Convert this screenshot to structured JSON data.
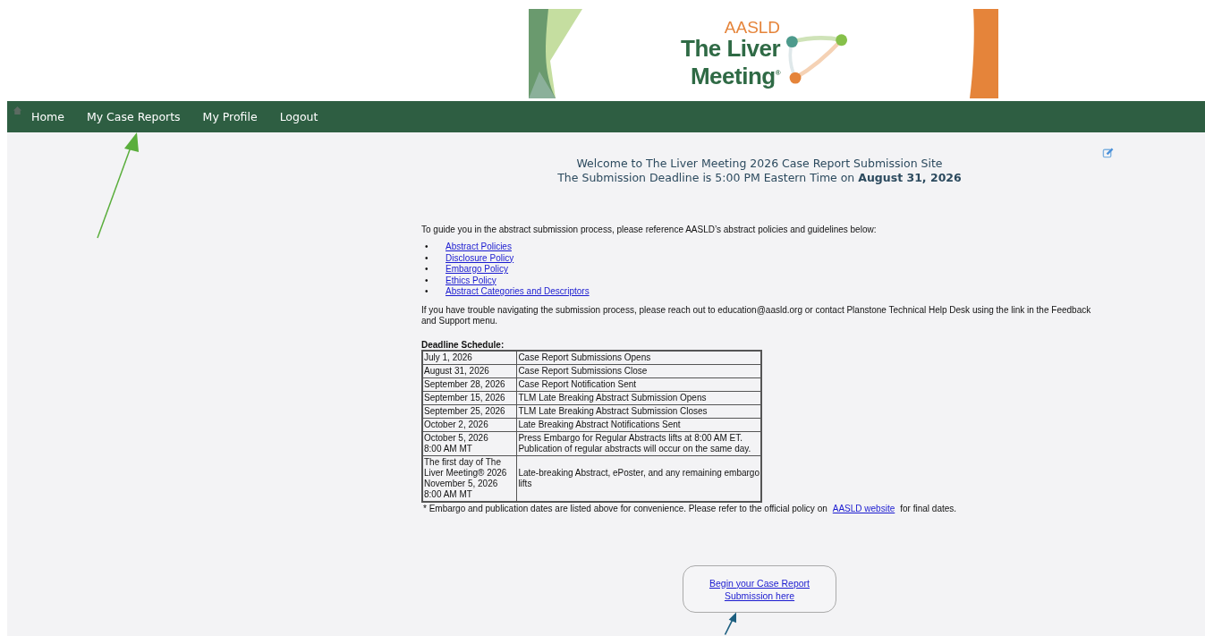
{
  "banner": {
    "org": "AASLD",
    "title": [
      "The Liver",
      "Meeting$^{®}$"
    ]
  },
  "nav": {
    "items": [
      {
        "label": "Home"
      },
      {
        "label": "My Case Reports"
      },
      {
        "label": "My Profile"
      },
      {
        "label": "Logout"
      }
    ]
  },
  "welcome": {
    "line1": "Welcome to The Liver Meeting 2026 Case Report Submission Site",
    "line2": "The Submission Deadline is 5:00 PM Eastern Time on **August 31, 2026**"
  },
  "intro": "To guide you in the abstract submission process, please reference AASLD’s abstract policies and guidelines below:",
  "links": [
    {
      "bullet": "•",
      "label": "Abstract Policies"
    },
    {
      "bullet": "•",
      "label": "Disclosure Policy"
    },
    {
      "bullet": "•",
      "label": "Embargo Policy"
    },
    {
      "bullet": "•",
      "label": "Ethics Policy"
    },
    {
      "bullet": "•",
      "label": "Abstract Categories and Descriptors"
    }
  ],
  "help": "If you have trouble navigating the submission process, please reach out to education@aasld.org or contact Planstone Technical Help Desk using the link in the Feedback and Support menu.",
  "schedule": {
    "heading": "Deadline Schedule:",
    "rows": [
      {
        "date": [
          "July 1, 2026"
        ],
        "event": [
          "Case Report Submissions Opens"
        ]
      },
      {
        "date": [
          "August 31, 2026"
        ],
        "event": [
          "Case Report Submissions Close"
        ]
      },
      {
        "date": [
          "September 28, 2026"
        ],
        "event": [
          "Case Report Notification Sent"
        ]
      },
      {
        "date": [
          "September 15, 2026"
        ],
        "event": [
          "TLM Late Breaking Abstract Submission Opens"
        ]
      },
      {
        "date": [
          "September 25, 2026"
        ],
        "event": [
          "TLM Late Breaking Abstract Submission Closes"
        ]
      },
      {
        "date": [
          "October 2, 2026"
        ],
        "event": [
          "Late Breaking Abstract Notifications Sent"
        ]
      },
      {
        "date": [
          "October 5, 2026",
          "8:00 AM MT"
        ],
        "event": [
          "Press Embargo for Regular Abstracts lifts at 8:00 AM ET.",
          "Publication of regular abstracts will occur on the same day."
        ]
      },
      {
        "date": [
          "The first day of The",
          "Liver Meeting® 2026",
          "November 5, 2026",
          "8:00 AM MT"
        ],
        "event": [
          "Late-breaking Abstract, ePoster, and any remaining embargo",
          "lifts"
        ]
      }
    ]
  },
  "footnote": {
    "text": "* Embargo and publication dates are listed above for convenience. Please refer to the official policy on",
    "link": "AASLD website",
    "tail": "for final dates."
  },
  "submit_button": [
    "Begin your Case Report",
    "Submission here"
  ]
}
